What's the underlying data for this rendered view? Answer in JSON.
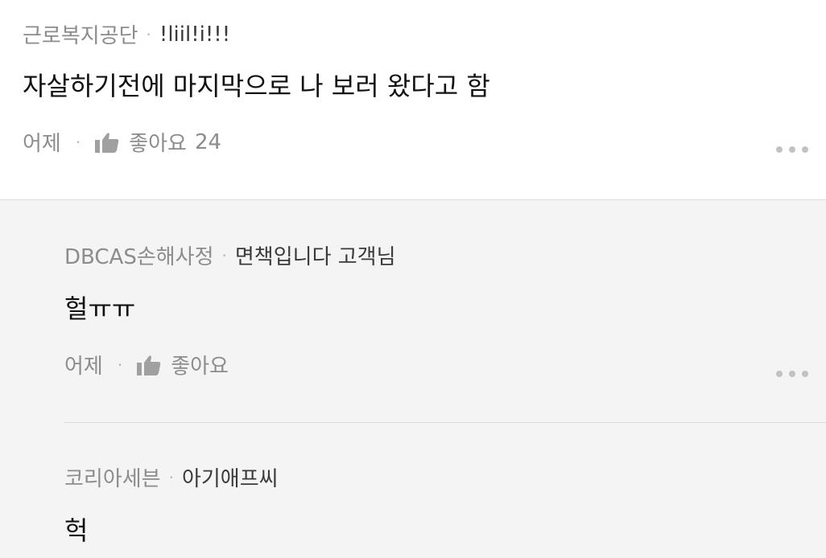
{
  "comment": {
    "author": "근로복지공단",
    "subname": "!liil!i!!!",
    "text": "자살하기전에 마지막으로 나 보러 왔다고 함",
    "time": "어제",
    "like_label": "좋아요",
    "like_count": "24"
  },
  "replies": [
    {
      "author": "DBCAS손해사정",
      "subname": "면책입니다 고객님",
      "text": "헐ㅠㅠ",
      "time": "어제",
      "like_label": "좋아요"
    },
    {
      "author": "코리아세븐",
      "subname": "아기애프씨",
      "text": "헉"
    }
  ],
  "icons": {
    "like": "thumbs-up-icon",
    "more": "more-dots-icon"
  },
  "colors": {
    "background": "#ffffff",
    "reply_background": "#f4f4f4",
    "muted_text": "#8c8c8c",
    "text": "#111111"
  }
}
